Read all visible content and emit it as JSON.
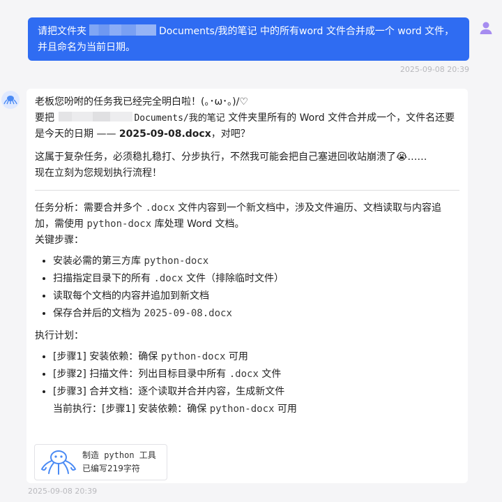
{
  "user_message": {
    "part1": "请把文件夹",
    "part2": "Documents/我的笔记 中的所有word 文件合并成一个 word 文件，并且命名为当前日期。",
    "timestamp": "2025-09-08 20:39"
  },
  "bot_message": {
    "greeting": "老板您吩咐的任务我已经完全明白啦！(｡･ω･｡)/♡",
    "confirm_pre": "要把",
    "confirm_path": "Documents/我的笔记",
    "confirm_mid": "文件夹里所有的 Word 文件合并成一个，文件名还要是今天的日期 ——",
    "confirm_filename": "2025-09-08.docx",
    "confirm_post": "，对吧？",
    "complex_note": "这属于复杂任务，必须稳扎稳打、分步执行，不然我可能会把自己塞进回收站崩溃了😭……",
    "plan_intro": "现在立刻为您规划执行流程！",
    "analysis_label": "任务分析：需要合并多个",
    "analysis_code1": ".docx",
    "analysis_mid": "文件内容到一个新文档中，涉及文件遍历、文档读取与内容追加，需使用",
    "analysis_code2": "python-docx",
    "analysis_end": "库处理 Word 文档。",
    "steps_title": "关键步骤：",
    "steps": [
      {
        "text": "安装必需的第三方库",
        "code": "python-docx",
        "suffix": ""
      },
      {
        "text": "扫描指定目录下的所有",
        "code": ".docx",
        "suffix": "文件（排除临时文件）"
      },
      {
        "text": "读取每个文档的内容并追加到新文档",
        "code": "",
        "suffix": ""
      },
      {
        "text": "保存合并后的文档为",
        "code": "2025-09-08.docx",
        "suffix": ""
      }
    ],
    "plan_title": "执行计划：",
    "plan": [
      {
        "text": "[步骤1] 安装依赖：确保",
        "code": "python-docx",
        "suffix": "可用"
      },
      {
        "text": "[步骤2] 扫描文件：列出目标目录中所有",
        "code": ".docx",
        "suffix": "文件"
      },
      {
        "text": "[步骤3] 合并文档：逐个读取并合并内容，生成新文件",
        "code": "",
        "suffix": ""
      }
    ],
    "current_pre": "当前执行：[步骤1] 安装依赖：确保",
    "current_code": "python-docx",
    "current_post": "可用",
    "tool_title": "制造 python 工具",
    "tool_status": "已编写219字符",
    "timestamp": "2025-09-08 20:39"
  },
  "colors": {
    "user_bubble": "#2f6cf2",
    "background": "#f5f5f7",
    "card": "#ffffff",
    "avatar_purple": "#a68cf0",
    "bot_icon_blue": "#4a8af4"
  },
  "icons": {
    "user_avatar": "person-icon",
    "bot_avatar": "octopus-icon",
    "tool": "octopus-icon"
  }
}
